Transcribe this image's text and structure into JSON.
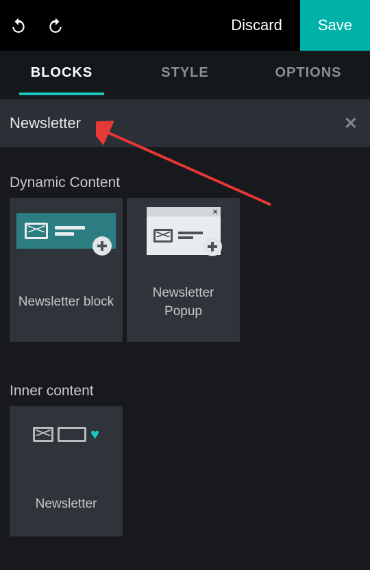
{
  "topbar": {
    "discard_label": "Discard",
    "save_label": "Save"
  },
  "tabs": {
    "blocks": "BLOCKS",
    "style": "STYLE",
    "options": "OPTIONS",
    "active": "blocks"
  },
  "search": {
    "value": "Newsletter",
    "clear_icon": "close-icon"
  },
  "sections": {
    "dynamic": {
      "title": "Dynamic Content",
      "blocks": [
        {
          "label": "Newsletter block"
        },
        {
          "label": "Newsletter Popup"
        }
      ]
    },
    "inner": {
      "title": "Inner content",
      "blocks": [
        {
          "label": "Newsletter"
        }
      ]
    }
  },
  "colors": {
    "accent": "#00b2a9",
    "accent_light": "#18c8c0"
  }
}
